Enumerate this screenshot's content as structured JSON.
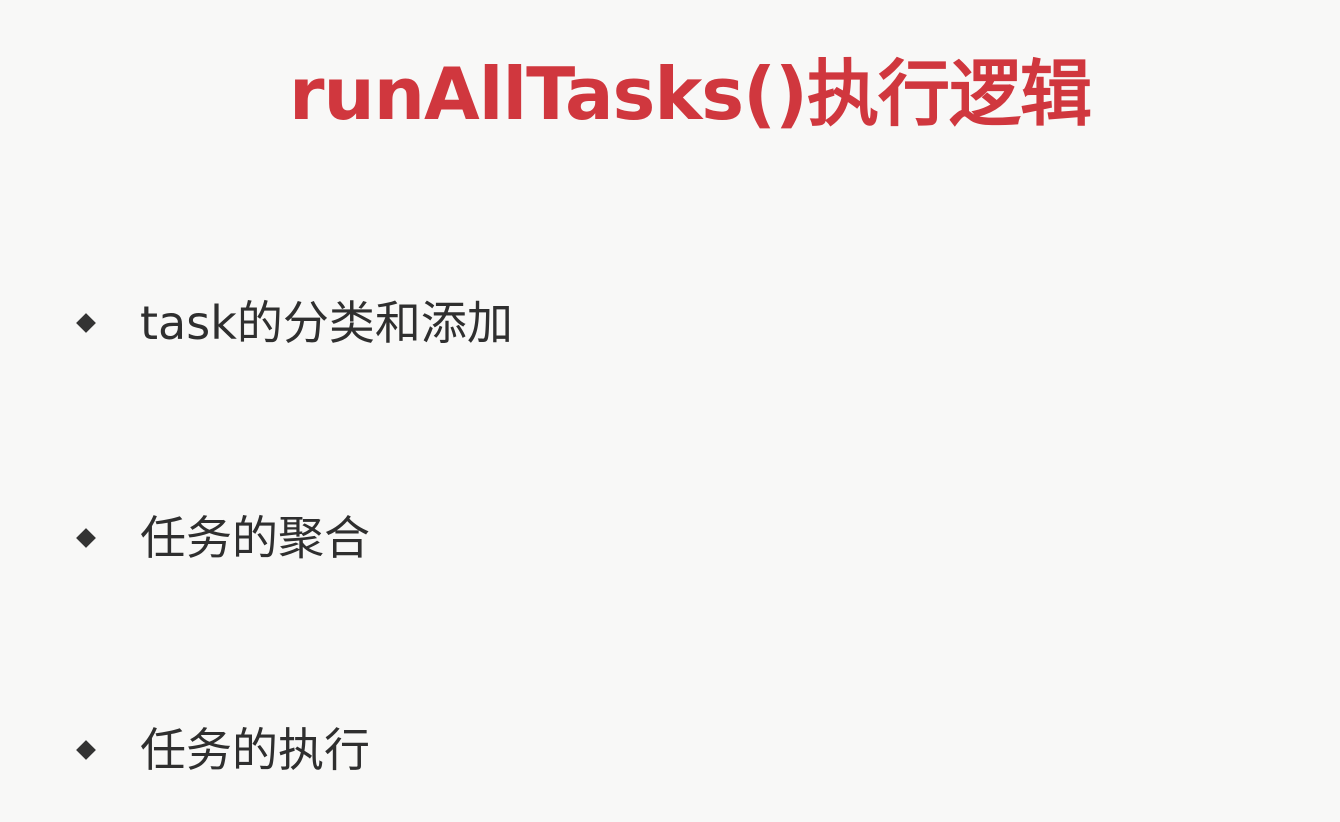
{
  "slide": {
    "title": "runAllTasks()执行逻辑",
    "bullets": [
      {
        "text": "task的分类和添加",
        "icon": "diamond-bullet-icon"
      },
      {
        "text": "任务的聚合",
        "icon": "diamond-bullet-icon"
      },
      {
        "text": "任务的执行",
        "icon": "diamond-bullet-icon"
      }
    ]
  },
  "colors": {
    "title": "#d0373e",
    "body_text": "#2f2f2f",
    "bullet": "#333333",
    "background": "#f8f8f7"
  }
}
